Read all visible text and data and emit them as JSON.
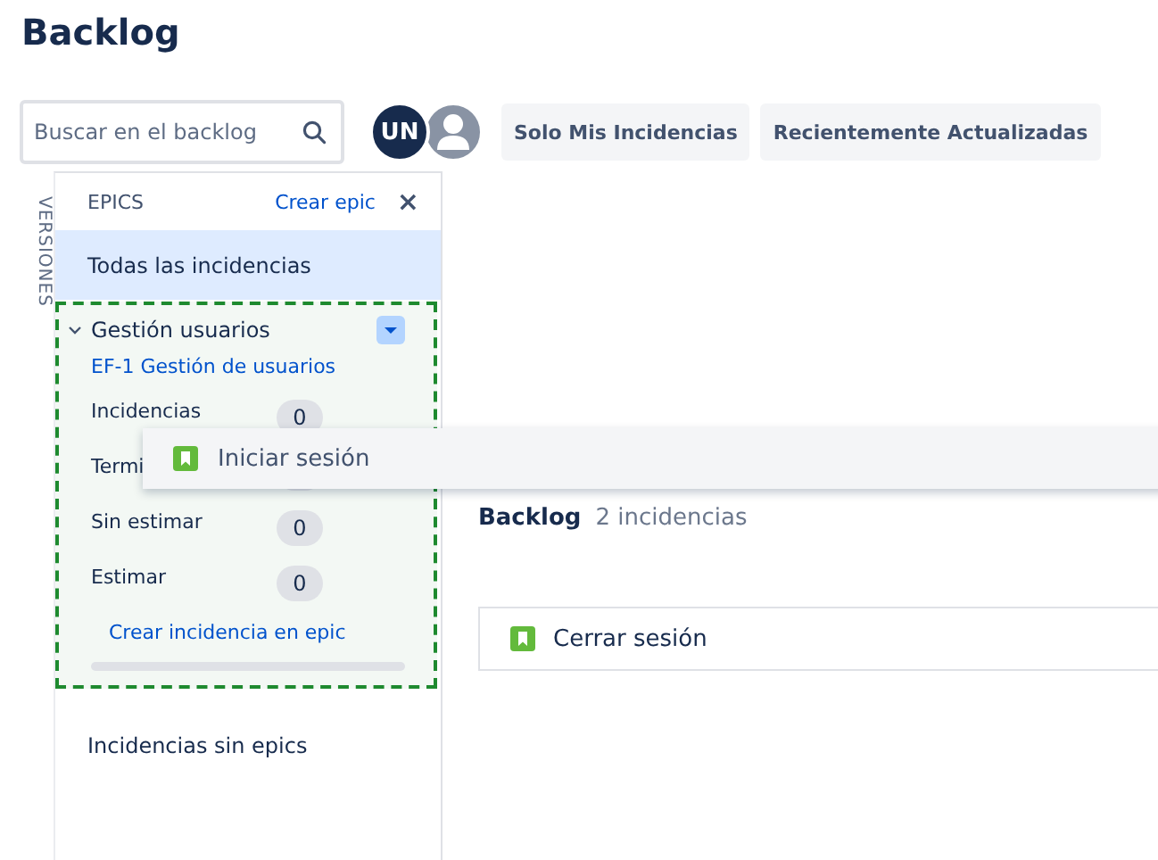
{
  "page_title": "Backlog",
  "search": {
    "placeholder": "Buscar en el backlog"
  },
  "avatars": [
    {
      "kind": "initials",
      "text": "UN"
    },
    {
      "kind": "silhouette"
    }
  ],
  "filters": [
    {
      "label": "Solo Mis Incidencias",
      "selected": false
    },
    {
      "label": "Recientemente Actualizadas",
      "selected": false
    }
  ],
  "side_tab": "VERSIONES",
  "epics_panel": {
    "title": "EPICS",
    "create_link": "Crear epic",
    "close": "×",
    "items": [
      {
        "kind": "plain",
        "label": "Todas las incidencias",
        "selected": true
      },
      {
        "kind": "epic",
        "label": "Gestión usuarios",
        "selected": false,
        "expanded": true,
        "key": "EF-1 Gestión de usuarios",
        "stats": [
          {
            "label": "Incidencias",
            "count": "0"
          },
          {
            "label": "Termi"
          },
          {
            "label": "Sin estimar",
            "count": "0"
          },
          {
            "label": "Estimar",
            "count": "0"
          }
        ],
        "create_link": "Crear incidencia en epic"
      },
      {
        "kind": "plain",
        "label": "Incidencias sin epics",
        "selected": false
      }
    ]
  },
  "backlog": {
    "title": "Backlog",
    "count": "2 incidencias",
    "issues": [
      {
        "summary": "Cerrar sesión"
      }
    ]
  },
  "dragged_issue": {
    "summary": "Iniciar sesión"
  }
}
